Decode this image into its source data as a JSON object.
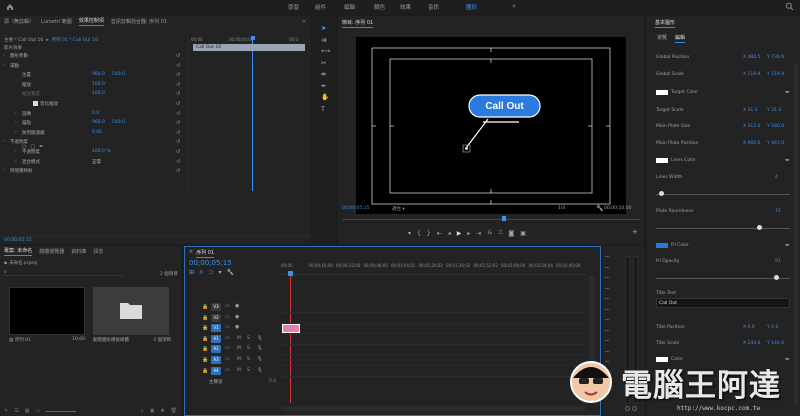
{
  "topbar": {
    "nav": [
      {
        "label": "學習",
        "active": false
      },
      {
        "label": "組件",
        "active": false
      },
      {
        "label": "編輯",
        "active": false
      },
      {
        "label": "顏色",
        "active": false
      },
      {
        "label": "效果",
        "active": false
      },
      {
        "label": "音訊",
        "active": false
      },
      {
        "label": "圖形",
        "active": true
      }
    ]
  },
  "source_panel": {
    "tabs": [
      {
        "label": "源（無剪輯）",
        "active": false
      },
      {
        "label": "Lumetri 範圍",
        "active": false
      },
      {
        "label": "效果控制項",
        "active": true
      },
      {
        "label": "音訊剪輯混合器: 序列 01",
        "active": false
      }
    ],
    "path_main": "主要 * Call Out 16",
    "path_seq": "序列 01 * Call Out 16",
    "mini_time_labels": [
      "00;00",
      "00;00;04;00",
      "00;0"
    ],
    "clip_label": "Call Out 16",
    "video_effects_label": "影片效果",
    "rows": [
      {
        "label": "圖形參數",
        "v1": "",
        "v2": ""
      },
      {
        "label": "運動",
        "v1": "",
        "v2": ""
      },
      {
        "label": "位置",
        "v1": "960.0",
        "v2": "540.0"
      },
      {
        "label": "縮放",
        "v1": "100.0",
        "v2": ""
      },
      {
        "label": "縮放寬度",
        "v1": "100.0",
        "v2": ""
      },
      {
        "label": "等比縮放",
        "v1": "",
        "v2": ""
      },
      {
        "label": "旋轉",
        "v1": "0.0",
        "v2": ""
      },
      {
        "label": "錨點",
        "v1": "960.0",
        "v2": "540.0"
      },
      {
        "label": "防閃爍濾鏡",
        "v1": "0.00",
        "v2": ""
      },
      {
        "label": "不透明度",
        "v1": "",
        "v2": ""
      },
      {
        "label": "不透明度",
        "v1": "100.0 %",
        "v2": ""
      },
      {
        "label": "混合模式",
        "v1": "正常",
        "v2": ""
      },
      {
        "label": "時間重映射",
        "v1": "",
        "v2": ""
      }
    ],
    "timecode": "00;00;05;15"
  },
  "program": {
    "title": "節目: 序列 01",
    "callout_text": "Call Out",
    "timecode": "00;00;05;15",
    "fit": "適合",
    "quality": "1/4",
    "duration": "00;00;10;00"
  },
  "essential": {
    "title": "基本圖形",
    "tabs": [
      {
        "label": "瀏覽",
        "active": false
      },
      {
        "label": "編輯",
        "active": true
      }
    ],
    "rows": [
      {
        "label": "Global Position",
        "x": "X 484.5",
        "y": "Y 739.6"
      },
      {
        "label": "Global Scale",
        "x": "X 119.9",
        "y": "Y 119.9"
      },
      {
        "label": "Target Color",
        "x": "",
        "y": ""
      },
      {
        "label": "Target Scale",
        "x": "X 31.3",
        "y": "Y 31.3"
      },
      {
        "label": "Main Plate Size",
        "x": "X 412.0",
        "y": "Y 180.0"
      },
      {
        "label": "Main Plate Position",
        "x": "X 960.0",
        "y": "Y 467.0"
      },
      {
        "label": "Lines Color",
        "x": "",
        "y": ""
      },
      {
        "label": "Lines Width",
        "x": "",
        "y": "4"
      },
      {
        "label": "Plate Roundness",
        "x": "",
        "y": "72"
      },
      {
        "label": "P.l Color",
        "x": "",
        "y": ""
      },
      {
        "label": "P.l Opacity",
        "x": "",
        "y": "91"
      },
      {
        "label": "Title Text",
        "x": "",
        "y": ""
      },
      {
        "label": "Title Position",
        "x": "X 0.0",
        "y": "Y 0.0"
      },
      {
        "label": "Title Scale",
        "x": "X 144.6",
        "y": "Y 144.6"
      },
      {
        "label": "Color",
        "x": "",
        "y": ""
      }
    ],
    "title_text_value": "Call Out",
    "lines_width_slider": 0.02,
    "roundness_slider": 0.78,
    "opacity_slider": 0.91,
    "colors": {
      "white": "#ffffff",
      "blue": "#2a7ae0"
    }
  },
  "project": {
    "tabs": [
      {
        "label": "專案: 未命名",
        "active": true
      },
      {
        "label": "媒體瀏覽器",
        "active": false
      },
      {
        "label": "資料庫",
        "active": false
      },
      {
        "label": "訊息",
        "active": false
      }
    ],
    "project_file": "未命名.prproj",
    "item_count": "2 個項目",
    "items": [
      {
        "name": "序列 01",
        "meta": "10;00"
      },
      {
        "name": "動態圖形模板媒體",
        "meta": "4 個項目"
      }
    ]
  },
  "timeline": {
    "tab": "序列 01",
    "timecode": "00;00;05;15",
    "ruler": [
      "00;00",
      "00;00;16;00",
      "00;00;32;00",
      "00;00;48;00",
      "00;01;04;02",
      "00;01;20;02",
      "00;01;36;02",
      "00;01;52;02",
      "00;02;08;04",
      "00;02;24;04",
      "00;02;40;04"
    ],
    "tracks": [
      {
        "name": "V3",
        "kind": "video"
      },
      {
        "name": "V2",
        "kind": "video"
      },
      {
        "name": "V1",
        "kind": "video"
      },
      {
        "name": "A1",
        "kind": "audio"
      },
      {
        "name": "A2",
        "kind": "audio"
      },
      {
        "name": "A3",
        "kind": "audio"
      },
      {
        "name": "A4",
        "kind": "audio"
      }
    ],
    "master_label": "主聲道",
    "master_value": "0.0",
    "clip_color": "#e87db0"
  },
  "watermark": {
    "name": "電腦王阿達",
    "url": "http://www.kocpc.com.tw"
  }
}
